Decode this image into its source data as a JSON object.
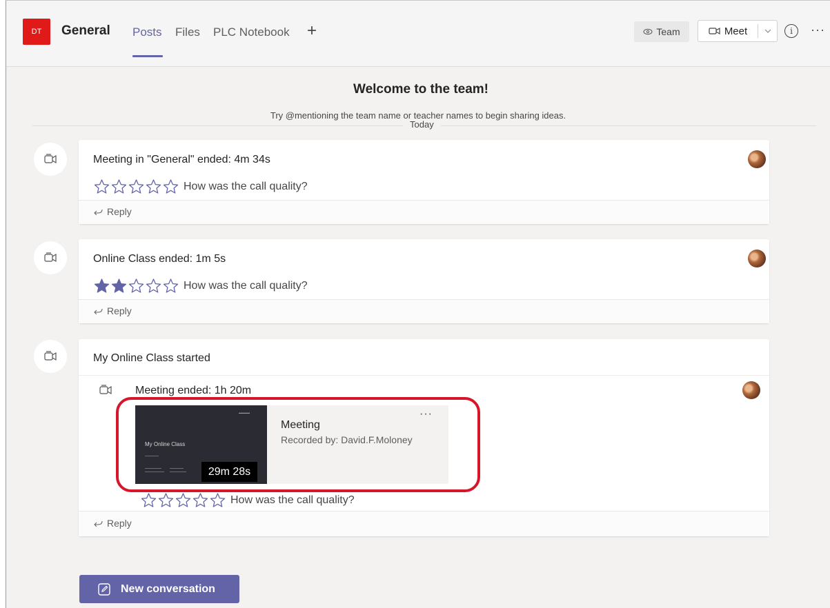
{
  "header": {
    "team_avatar_initials": "DT",
    "channel_name": "General",
    "tabs": [
      {
        "label": "Posts",
        "active": true
      },
      {
        "label": "Files",
        "active": false
      },
      {
        "label": "PLC Notebook",
        "active": false
      }
    ],
    "add_tab_icon": "plus-icon",
    "team_button": "Team",
    "meet_button": "Meet",
    "info_icon": "info-icon",
    "more_icon": "more-icon"
  },
  "welcome": {
    "title": "Welcome to the team!",
    "subtitle": "Try @mentioning the team name or teacher names to begin sharing ideas.",
    "date_divider": "Today"
  },
  "posts": [
    {
      "title": "Meeting in \"General\" ended: 4m 34s",
      "rating_prompt": "How was the call quality?",
      "stars_filled": 0,
      "stars_total": 5,
      "reply_label": "Reply"
    },
    {
      "title": "Online Class ended: 1m 5s",
      "rating_prompt": "How was the call quality?",
      "stars_filled": 2,
      "stars_total": 5,
      "reply_label": "Reply"
    },
    {
      "title": "My Online Class started",
      "nested_title": "Meeting ended: 1h 20m",
      "recording": {
        "name": "Meeting",
        "recorded_by": "Recorded by: David.F.Moloney",
        "duration": "29m 28s",
        "thumbnail_title": "My Online Class"
      },
      "rating_prompt": "How was the call quality?",
      "stars_filled": 0,
      "stars_total": 5,
      "reply_label": "Reply"
    }
  ],
  "new_conversation_label": "New conversation",
  "colors": {
    "accent": "#6264a7",
    "team_avatar": "#e01919",
    "highlight": "#d6162b"
  }
}
